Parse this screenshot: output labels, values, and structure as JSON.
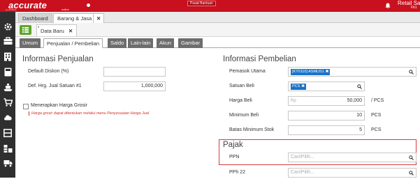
{
  "app": {
    "logo": "accurate",
    "logo_sub": "online",
    "logo_tag": "by CPSSoft",
    "support_button": "Pusat Bantuan",
    "company": "Retail Sa",
    "company_sub": "Fb1",
    "brand_color": "#c8101e"
  },
  "sidebar": {
    "icons": [
      "gear-icon",
      "briefcase-icon",
      "building-icon",
      "calculator-icon",
      "cart-loaded-icon",
      "shopping-cart-icon",
      "cloud-icon",
      "box-icon",
      "stack-icon",
      "truck-icon"
    ]
  },
  "tabs": [
    {
      "label": "Dashboard",
      "active": false
    },
    {
      "label": "Barang & Jasa",
      "active": true
    }
  ],
  "tab_close": "✕",
  "subtab": {
    "label": "Data Baru",
    "close": "✕",
    "star": "*"
  },
  "form_tabs": [
    "Umum",
    "Penjualan / Pembelian",
    "Saldo",
    "Lain-lain",
    "Akun",
    "Gambar"
  ],
  "active_form_tab": "Penjualan / Pembelian",
  "penjualan": {
    "title": "Informasi Penjualan",
    "default_diskon_label": "Default Diskon (%)",
    "default_diskon_value": "",
    "harga_jual_label": "Def. Hrg. Jual Satuan #1",
    "harga_jual_value": "1,000,000",
    "grosir_label": "Menerapkan Harga Grosir",
    "grosir_checked": false,
    "grosir_hint": "Harga grosir dapat ditentukan melalui menu Penyesuaian Harga Jual"
  },
  "pembelian": {
    "title": "Informasi Pembelian",
    "pemasok_label": "Pemasok Utama",
    "pemasok_chip": "[KT0110] ASMUS1",
    "satuan_label": "Satuan Beli",
    "satuan_chip": "PCS",
    "harga_label": "Harga Beli",
    "harga_prefix": "Rp",
    "harga_value": "50,000",
    "harga_unit": "/ PCS",
    "minimum_label": "Minimum Beli",
    "minimum_value": "10",
    "minimum_unit": "PCS",
    "batas_label": "Batas Minimum Stok",
    "batas_value": "5",
    "batas_unit": "PCS"
  },
  "pajak": {
    "title": "Pajak",
    "ppn_label": "PPN",
    "ppn_placeholder": "Cari/Pilih...",
    "pph_label": "PPh 22",
    "pph_placeholder": "Cari/Pilih..."
  }
}
